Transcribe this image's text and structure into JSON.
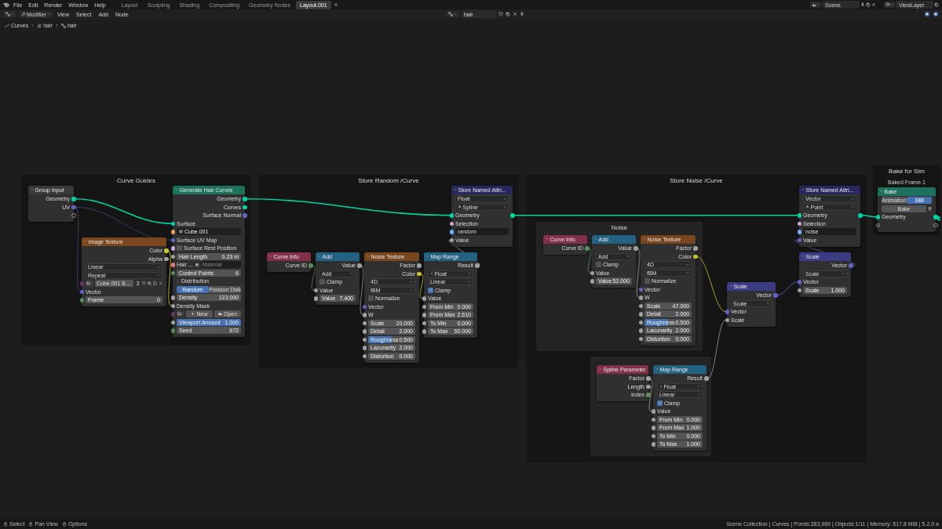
{
  "topbar": {
    "menus": [
      "File",
      "Edit",
      "Render",
      "Window",
      "Help"
    ],
    "workspaces": [
      {
        "label": "Layout",
        "selected": false
      },
      {
        "label": "Sculpting",
        "selected": false
      },
      {
        "label": "Shading",
        "selected": false
      },
      {
        "label": "Compositing",
        "selected": false
      },
      {
        "label": "Geometry Nodes",
        "selected": false
      },
      {
        "label": "Layout.001",
        "selected": true
      }
    ],
    "scene": "Scene",
    "view_layer": "ViewLayer"
  },
  "header": {
    "mode": "Modifier",
    "menus": [
      "View",
      "Select",
      "Add",
      "Node"
    ],
    "node_tree": "hair"
  },
  "breadcrumb": [
    "Curves",
    "hair",
    "hair"
  ],
  "frames": [
    {
      "kind": "frame",
      "label": "Curve Guides"
    },
    {
      "kind": "frame",
      "label": "Store Random /Curve"
    },
    {
      "kind": "frame",
      "label": "Store Noise /Curve"
    },
    {
      "kind": "frame",
      "label": "Noise"
    },
    {
      "kind": "frame"
    },
    {
      "kind": "frame",
      "label": "Bake for Sim"
    }
  ],
  "nodes": [
    {
      "title": "Group Input",
      "kind": "group",
      "rows": [
        {
          "kind": "out",
          "label": "Geometry",
          "socket": {
            "color": "#00d6a3"
          }
        },
        {
          "kind": "out",
          "label": "UV",
          "socket": {
            "color": "#6363c7"
          }
        },
        {
          "kind": "out",
          "socket": {
            "kind": "empty"
          }
        }
      ]
    },
    {
      "title": "Generate Hair Curves",
      "kind": "geometry",
      "rows": [
        {
          "kind": "out",
          "label": "Geometry",
          "socket": {
            "color": "#00d6a3"
          }
        },
        {
          "kind": "out",
          "label": "Curves",
          "socket": {
            "color": "#00d6a3"
          }
        },
        {
          "kind": "out",
          "label": "Surface Normal",
          "socket": {
            "color": "#6363c7"
          }
        },
        {
          "kind": "in",
          "label": "Surface",
          "socket": {
            "color": "#00d6a3"
          }
        },
        {
          "kind": "object",
          "value": "Cube.001",
          "socket": {
            "color": "#ed9e5c"
          }
        },
        {
          "kind": "in",
          "label": "Surface UV Map",
          "socket": {
            "color": "#6363c7"
          }
        },
        {
          "kind": "checkbox",
          "label": "Surface Rest Position",
          "checked": false,
          "socket": {
            "color": "#cca6d6"
          }
        },
        {
          "kind": "field",
          "label": "Hair Length",
          "value": "0.23 m",
          "socket": {
            "color": "#a1a1a1"
          }
        },
        {
          "kind": "material",
          "label": "Hair ...",
          "placeholder": "Material",
          "socket": {
            "color": "#eb7582"
          }
        },
        {
          "kind": "field",
          "label": "Control Points",
          "value": "6",
          "socket": {
            "color": "#598c5c"
          }
        },
        {
          "kind": "panel",
          "label": "Distribution",
          "expanded": true
        },
        {
          "kind": "toggle",
          "options": [
            {
              "label": "Random",
              "selected": true
            },
            {
              "label": "Poisson Disk",
              "selected": false
            }
          ]
        },
        {
          "kind": "field",
          "label": "Density",
          "value": "123.000",
          "socket": {
            "color": "#a1a1a1"
          }
        },
        {
          "kind": "in",
          "label": "Density Mask",
          "socket": {
            "color": "#a1a1a1"
          }
        },
        {
          "kind": "image_new",
          "buttons": [
            "New",
            "Open"
          ],
          "socket": {
            "color": "#633863"
          }
        },
        {
          "kind": "field",
          "label": "Viewport Amount",
          "value": "1.000",
          "level": 1,
          "socket": {
            "color": "#a1a1a1"
          }
        },
        {
          "kind": "field",
          "label": "Seed",
          "value": "672",
          "socket": {
            "color": "#598c5c"
          }
        }
      ]
    },
    {
      "title": "Image Texture",
      "kind": "texture",
      "rows": [
        {
          "kind": "out",
          "label": "Color",
          "socket": {
            "color": "#c7c729"
          }
        },
        {
          "kind": "out",
          "label": "Alpha",
          "socket": {
            "color": "#a1a1a1"
          }
        },
        {
          "kind": "dropdown",
          "value": "Linear"
        },
        {
          "kind": "dropdown",
          "value": "Repeat"
        },
        {
          "kind": "image",
          "value": "Cube.001 B...",
          "users": "3",
          "socket": {
            "color": "#633863"
          }
        },
        {
          "kind": "in",
          "label": "Vector",
          "socket": {
            "color": "#6363c7"
          }
        },
        {
          "kind": "field",
          "label": "Frame",
          "value": "0",
          "socket": {
            "color": "#598c5c"
          }
        }
      ]
    },
    {
      "title": "Store Named Attri...",
      "kind": "attribute",
      "rows": [
        {
          "kind": "dropdown",
          "value": "Float"
        },
        {
          "kind": "domain",
          "value": "Spline"
        },
        {
          "kind": "through",
          "label": "Geometry",
          "socket": {
            "color": "#00d6a3"
          }
        },
        {
          "kind": "in",
          "label": "Selection",
          "socket": {
            "color": "#cca6d6"
          }
        },
        {
          "kind": "string",
          "value": "random",
          "socket": {
            "color": "#70b2ff"
          }
        },
        {
          "kind": "in",
          "label": "Value",
          "socket": {
            "color": "#a1a1a1"
          }
        }
      ]
    },
    {
      "title": "Curve Info",
      "kind": "input",
      "rows": [
        {
          "kind": "out",
          "label": "Curve ID",
          "socket": {
            "color": "#598c5c"
          }
        }
      ]
    },
    {
      "title": "Add",
      "kind": "converter",
      "rows": [
        {
          "kind": "out",
          "label": "Value",
          "socket": {
            "color": "#a1a1a1"
          }
        },
        {
          "kind": "dropdown",
          "value": "Add"
        },
        {
          "kind": "checkbox",
          "label": "Clamp",
          "checked": false
        },
        {
          "kind": "in",
          "label": "Value",
          "socket": {
            "color": "#a1a1a1"
          }
        },
        {
          "kind": "field",
          "label": "Value",
          "value": "7.400",
          "socket": {
            "color": "#a1a1a1"
          }
        }
      ]
    },
    {
      "title": "Noise Texture",
      "kind": "texture",
      "rows": [
        {
          "kind": "out",
          "label": "Factor",
          "socket": {
            "color": "#a1a1a1"
          }
        },
        {
          "kind": "out",
          "label": "Color",
          "socket": {
            "color": "#c7c729"
          }
        },
        {
          "kind": "dropdown",
          "value": "4D"
        },
        {
          "kind": "dropdown",
          "value": "fBM"
        },
        {
          "kind": "checkbox",
          "label": "Normalize",
          "checked": false
        },
        {
          "kind": "in",
          "label": "Vector",
          "socket": {
            "color": "#6363c7"
          }
        },
        {
          "kind": "in",
          "label": "W",
          "socket": {
            "color": "#a1a1a1"
          }
        },
        {
          "kind": "field",
          "label": "Scale",
          "value": "20.000",
          "socket": {
            "color": "#a1a1a1"
          }
        },
        {
          "kind": "field",
          "label": "Detail",
          "value": "2.000",
          "socket": {
            "color": "#a1a1a1"
          }
        },
        {
          "kind": "field",
          "label": "Roughness",
          "value": "0.500",
          "level": 0.5,
          "socket": {
            "color": "#a1a1a1"
          }
        },
        {
          "kind": "field",
          "label": "Lacunarity",
          "value": "2.000",
          "socket": {
            "color": "#a1a1a1"
          }
        },
        {
          "kind": "field",
          "label": "Distortion",
          "value": "0.000",
          "socket": {
            "color": "#a1a1a1"
          }
        }
      ]
    },
    {
      "title": "Map Range",
      "kind": "converter",
      "rows": [
        {
          "kind": "out",
          "label": "Result",
          "socket": {
            "color": "#a1a1a1"
          }
        },
        {
          "kind": "dtype",
          "value": "Float"
        },
        {
          "kind": "dropdown",
          "value": "Linear"
        },
        {
          "kind": "checkbox",
          "label": "Clamp",
          "checked": true
        },
        {
          "kind": "in",
          "label": "Value",
          "socket": {
            "color": "#a1a1a1"
          }
        },
        {
          "kind": "field",
          "label": "From Min",
          "value": "0.000",
          "socket": {
            "color": "#a1a1a1"
          }
        },
        {
          "kind": "field",
          "label": "From Max",
          "value": "2.610",
          "socket": {
            "color": "#a1a1a1"
          }
        },
        {
          "kind": "field",
          "label": "To Min",
          "value": "0.000",
          "socket": {
            "color": "#a1a1a1"
          }
        },
        {
          "kind": "field",
          "label": "To Max",
          "value": "50.000",
          "socket": {
            "color": "#a1a1a1"
          }
        }
      ]
    },
    {
      "title": "Store Named Attri...",
      "kind": "attribute",
      "rows": [
        {
          "kind": "dropdown",
          "value": "Vector"
        },
        {
          "kind": "domain",
          "value": "Point"
        },
        {
          "kind": "through",
          "label": "Geometry",
          "socket": {
            "color": "#00d6a3"
          }
        },
        {
          "kind": "in",
          "label": "Selection",
          "socket": {
            "color": "#cca6d6"
          }
        },
        {
          "kind": "string",
          "value": "noise",
          "socket": {
            "color": "#70b2ff"
          }
        },
        {
          "kind": "in",
          "label": "Value",
          "socket": {
            "color": "#6363c7"
          }
        }
      ]
    },
    {
      "title": "Scale",
      "kind": "vector",
      "rows": [
        {
          "kind": "out",
          "label": "Vector",
          "socket": {
            "color": "#6363c7"
          }
        },
        {
          "kind": "dropdown",
          "value": "Scale"
        },
        {
          "kind": "in",
          "label": "Vector",
          "socket": {
            "color": "#6363c7"
          }
        },
        {
          "kind": "field",
          "label": "Scale",
          "value": "1.000",
          "socket": {
            "color": "#a1a1a1"
          }
        }
      ]
    },
    {
      "title": "Bake",
      "kind": "geometry",
      "badge": "Baked Frame 1",
      "rows": [
        {
          "kind": "toggle",
          "options": [
            {
              "label": "Animation",
              "selected": false
            },
            {
              "label": "Still",
              "selected": true
            }
          ]
        },
        {
          "kind": "button",
          "label": "Bake"
        },
        {
          "kind": "through",
          "label": "Geometry",
          "socket": {
            "color": "#00d6a3"
          }
        },
        {
          "kind": "through",
          "socket": {
            "kind": "empty"
          }
        }
      ]
    },
    {
      "title": "Curve Info",
      "kind": "input",
      "rows": [
        {
          "kind": "out",
          "label": "Curve ID",
          "socket": {
            "color": "#598c5c"
          }
        }
      ]
    },
    {
      "title": "Add",
      "kind": "converter",
      "rows": [
        {
          "kind": "out",
          "label": "Value",
          "socket": {
            "color": "#a1a1a1"
          }
        },
        {
          "kind": "dropdown",
          "value": "Add"
        },
        {
          "kind": "checkbox",
          "label": "Clamp",
          "checked": false
        },
        {
          "kind": "in",
          "label": "Value",
          "socket": {
            "color": "#a1a1a1"
          }
        },
        {
          "kind": "field",
          "label": "Value",
          "value": "52.000",
          "socket": {
            "color": "#a1a1a1"
          }
        }
      ]
    },
    {
      "title": "Noise Texture",
      "kind": "texture",
      "rows": [
        {
          "kind": "out",
          "label": "Factor",
          "socket": {
            "color": "#a1a1a1"
          }
        },
        {
          "kind": "out",
          "label": "Color",
          "socket": {
            "color": "#c7c729"
          }
        },
        {
          "kind": "dropdown",
          "value": "4D"
        },
        {
          "kind": "dropdown",
          "value": "fBM"
        },
        {
          "kind": "checkbox",
          "label": "Normalize",
          "checked": false
        },
        {
          "kind": "in",
          "label": "Vector",
          "socket": {
            "color": "#6363c7"
          }
        },
        {
          "kind": "in",
          "label": "W",
          "socket": {
            "color": "#a1a1a1"
          }
        },
        {
          "kind": "field",
          "label": "Scale",
          "value": "47.000",
          "socket": {
            "color": "#a1a1a1"
          }
        },
        {
          "kind": "field",
          "label": "Detail",
          "value": "2.000",
          "socket": {
            "color": "#a1a1a1"
          }
        },
        {
          "kind": "field",
          "label": "Roughness",
          "value": "0.500",
          "level": 0.5,
          "socket": {
            "color": "#a1a1a1"
          }
        },
        {
          "kind": "field",
          "label": "Lacunarity",
          "value": "2.000",
          "socket": {
            "color": "#a1a1a1"
          }
        },
        {
          "kind": "field",
          "label": "Distortion",
          "value": "0.000",
          "socket": {
            "color": "#a1a1a1"
          }
        }
      ]
    },
    {
      "title": "Scale",
      "kind": "vector",
      "rows": [
        {
          "kind": "out",
          "label": "Vector",
          "socket": {
            "color": "#6363c7"
          }
        },
        {
          "kind": "dropdown",
          "value": "Scale"
        },
        {
          "kind": "in",
          "label": "Vector",
          "socket": {
            "color": "#6363c7"
          }
        },
        {
          "kind": "in",
          "label": "Scale",
          "socket": {
            "color": "#a1a1a1"
          }
        }
      ]
    },
    {
      "title": "Spline Parameter",
      "kind": "input",
      "rows": [
        {
          "kind": "out",
          "label": "Factor",
          "socket": {
            "color": "#a1a1a1"
          }
        },
        {
          "kind": "out",
          "label": "Length",
          "socket": {
            "color": "#a1a1a1"
          }
        },
        {
          "kind": "out",
          "label": "Index",
          "socket": {
            "color": "#598c5c"
          }
        }
      ]
    },
    {
      "title": "Map Range",
      "kind": "converter",
      "rows": [
        {
          "kind": "out",
          "label": "Result",
          "socket": {
            "color": "#a1a1a1"
          }
        },
        {
          "kind": "dtype",
          "value": "Float"
        },
        {
          "kind": "dropdown",
          "value": "Linear"
        },
        {
          "kind": "checkbox",
          "label": "Clamp",
          "checked": true
        },
        {
          "kind": "in",
          "label": "Value",
          "socket": {
            "color": "#a1a1a1"
          }
        },
        {
          "kind": "field",
          "label": "From Min",
          "value": "0.000",
          "socket": {
            "color": "#a1a1a1"
          }
        },
        {
          "kind": "field",
          "label": "From Max",
          "value": "1.000",
          "socket": {
            "color": "#a1a1a1"
          }
        },
        {
          "kind": "field",
          "label": "To Min",
          "value": "0.000",
          "socket": {
            "color": "#a1a1a1"
          }
        },
        {
          "kind": "field",
          "label": "To Max",
          "value": "1.000",
          "socket": {
            "color": "#a1a1a1"
          }
        }
      ]
    }
  ],
  "status_bar": {
    "hints": [
      "Select",
      "Pan View",
      "Options"
    ],
    "info": "Scene Collection | Curves | Points:283,969 | Objects:1/11 | Memory: 517.8 MiB | 5.2.0 a"
  }
}
